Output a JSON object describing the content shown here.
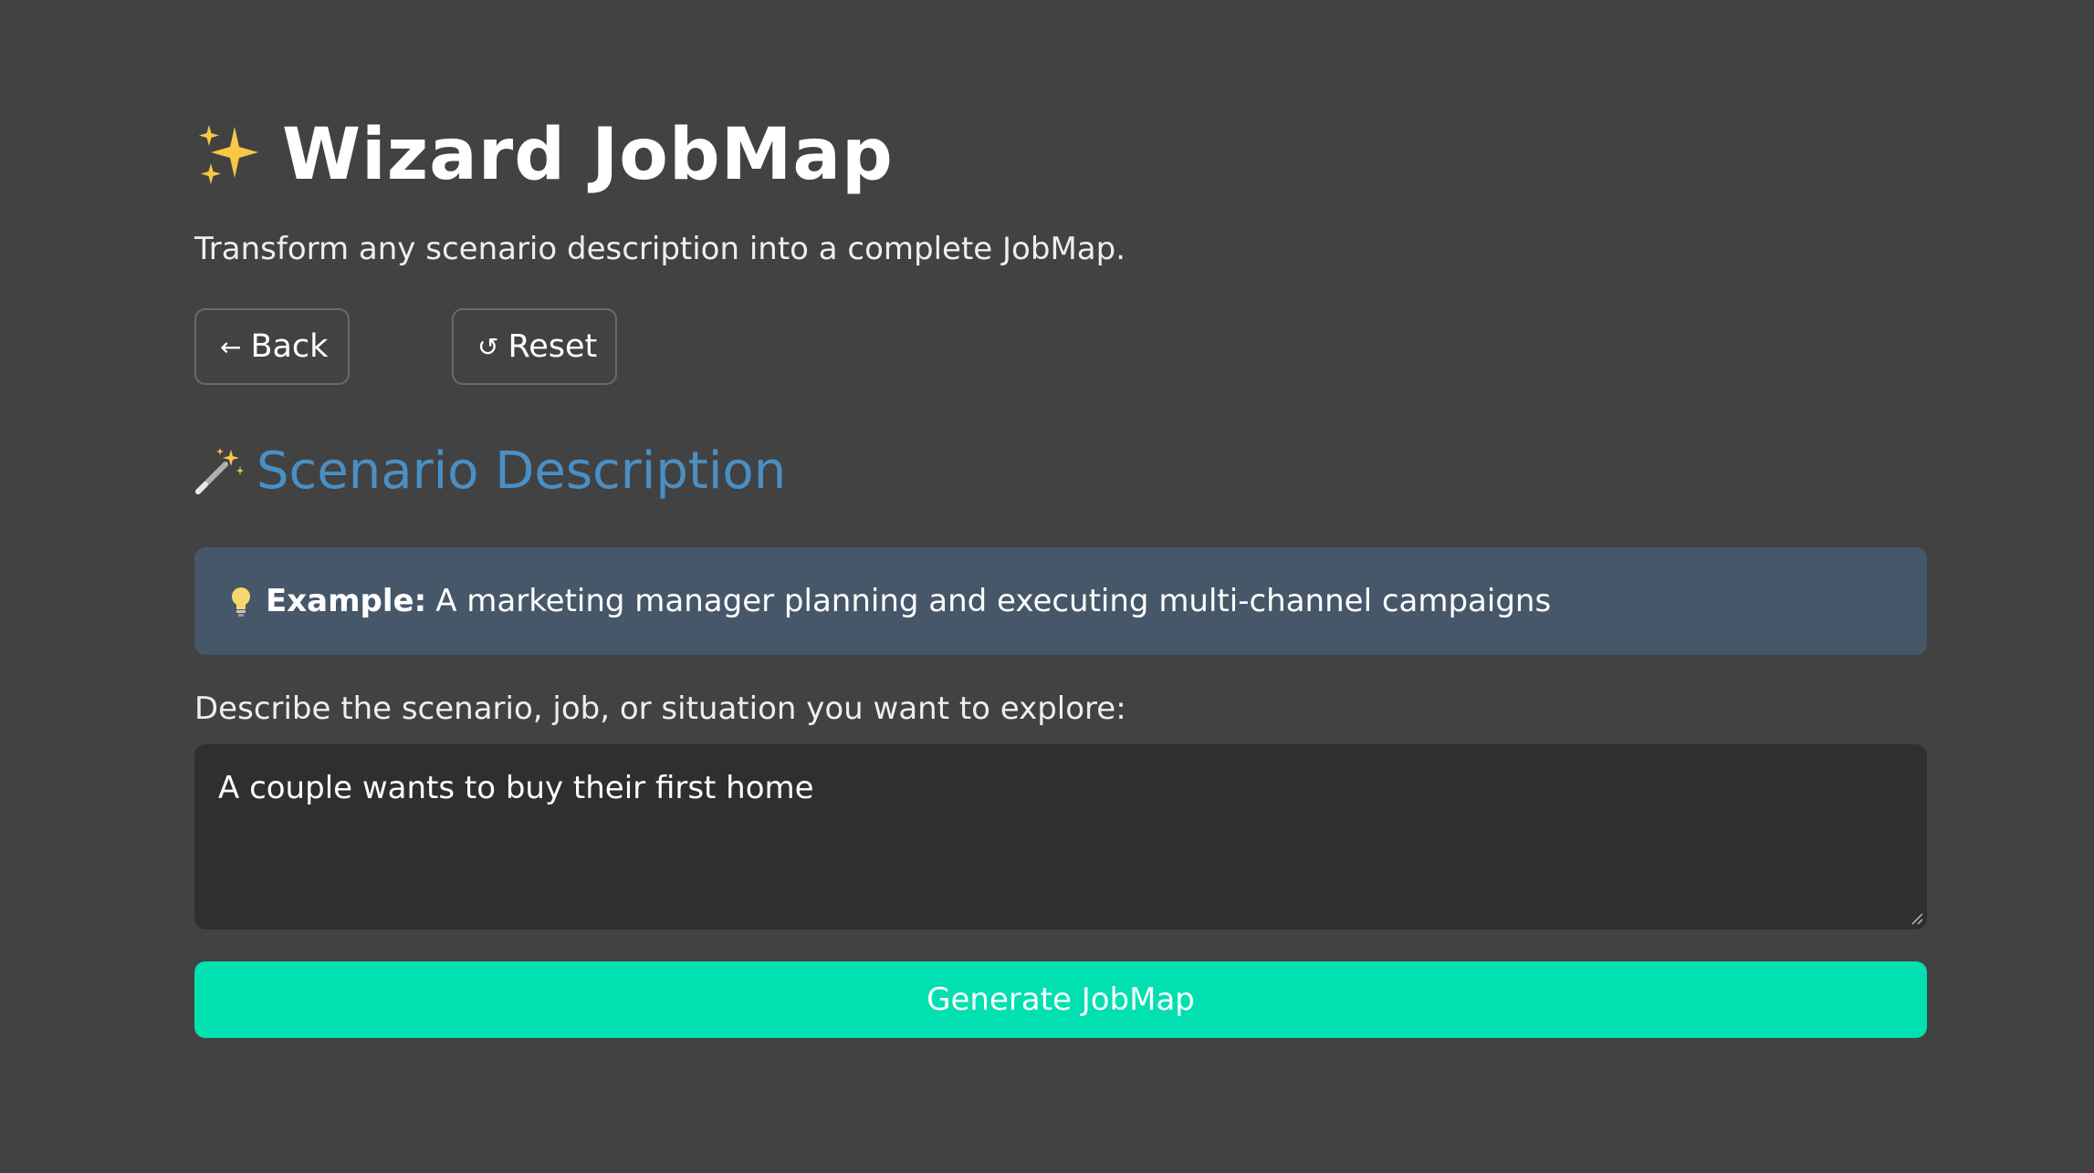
{
  "header": {
    "title": "Wizard JobMap",
    "subtitle": "Transform any scenario description into a complete JobMap.",
    "title_icon": "sparkles-icon"
  },
  "toolbar": {
    "back_label": "Back",
    "back_glyph": "←",
    "reset_label": "Reset",
    "reset_glyph": "↺"
  },
  "section": {
    "title": "Scenario Description",
    "icon": "magic-wand-icon"
  },
  "example": {
    "icon": "lightbulb-icon",
    "label": "Example:",
    "text": "A marketing manager planning and executing multi-channel campaigns"
  },
  "form": {
    "field_label": "Describe the scenario, job, or situation you want to explore:",
    "scenario_value": "A couple wants to buy their first home",
    "generate_label": "Generate JobMap"
  },
  "colors": {
    "background": "#424242",
    "accent_title": "#4a8fc4",
    "example_bg": "#465769",
    "input_bg": "#2f2f2f",
    "primary_button": "#00e0b0"
  }
}
